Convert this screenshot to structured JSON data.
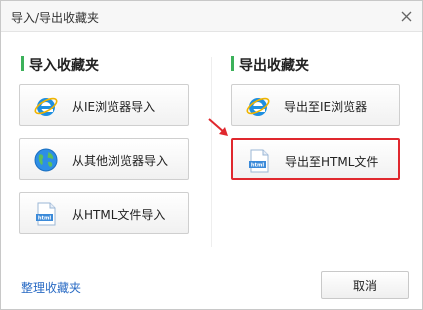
{
  "window": {
    "title": "导入/导出收藏夹"
  },
  "import": {
    "heading": "导入收藏夹",
    "buttons": [
      {
        "label": "从IE浏览器导入",
        "icon": "ie-icon"
      },
      {
        "label": "从其他浏览器导入",
        "icon": "globe-icon"
      },
      {
        "label": "从HTML文件导入",
        "icon": "html-file-icon"
      }
    ]
  },
  "export": {
    "heading": "导出收藏夹",
    "buttons": [
      {
        "label": "导出至IE浏览器",
        "icon": "ie-icon"
      },
      {
        "label": "导出至HTML文件",
        "icon": "html-file-icon",
        "highlighted": true
      }
    ]
  },
  "footer": {
    "organize_link": "整理收藏夹",
    "cancel_label": "取消"
  },
  "colors": {
    "accent_green": "#3cb15a",
    "highlight_red": "#e0282e",
    "link_blue": "#2a6bc4"
  }
}
